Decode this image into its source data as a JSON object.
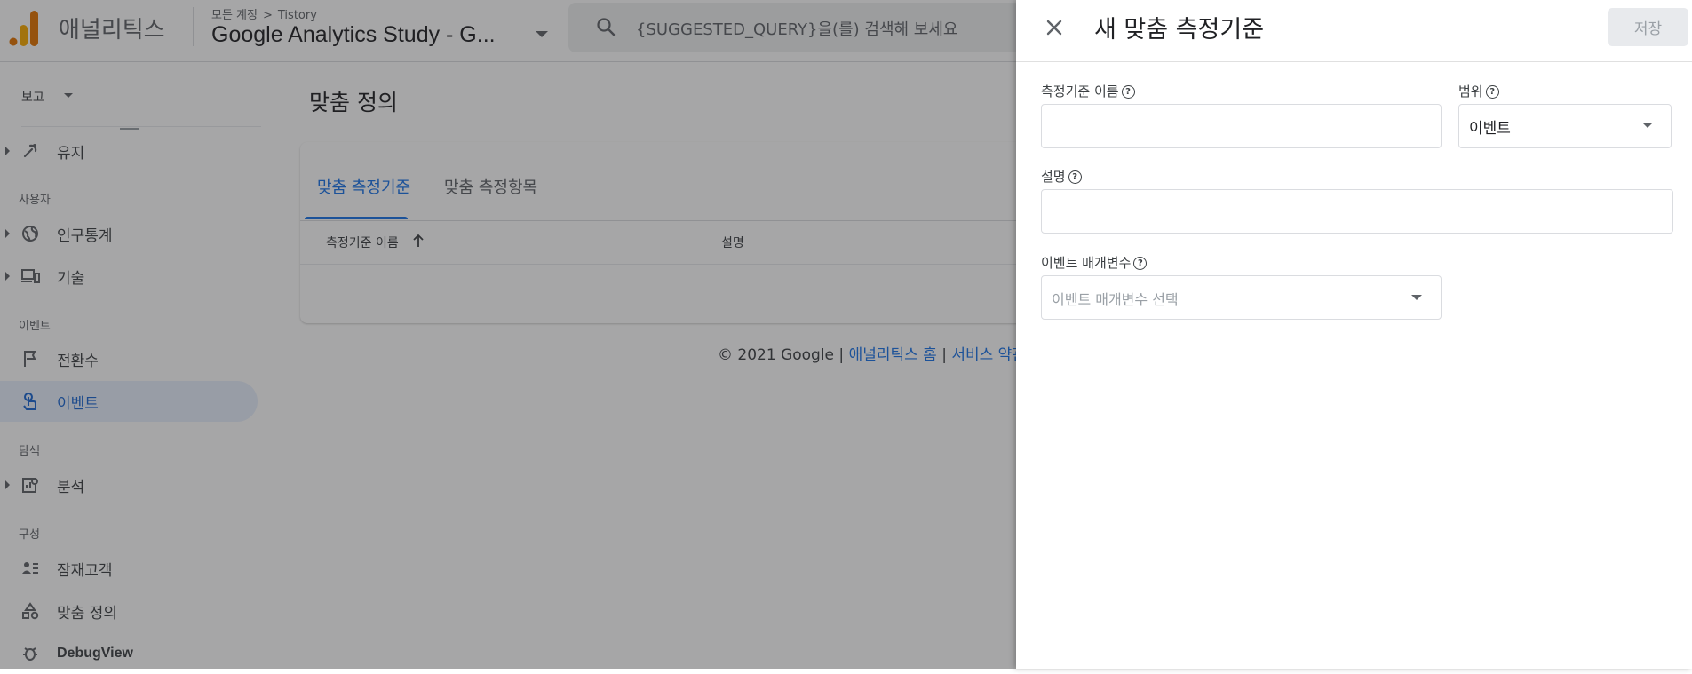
{
  "app": {
    "product_name": "애널리틱스",
    "breadcrumb": {
      "all_accounts": "모든 계정",
      "separator": ">",
      "account": "Tistory"
    },
    "property_name": "Google Analytics Study - G...",
    "search_placeholder": "{SUGGESTED_QUERY}을(를) 검색해 보세요"
  },
  "sidebar": {
    "report_selector": "보고",
    "items": [
      {
        "label": "유지",
        "icon": "retention-icon"
      },
      {
        "section": "사용자"
      },
      {
        "label": "인구통계",
        "icon": "globe-icon"
      },
      {
        "label": "기술",
        "icon": "devices-icon"
      },
      {
        "section": "이벤트"
      },
      {
        "label": "전환수",
        "icon": "flag-icon"
      },
      {
        "label": "이벤트",
        "icon": "touch-icon",
        "active": true
      },
      {
        "section": "탐색"
      },
      {
        "label": "분석",
        "icon": "analysis-icon"
      },
      {
        "section": "구성"
      },
      {
        "label": "잠재고객",
        "icon": "audience-icon"
      },
      {
        "label": "맞춤 정의",
        "icon": "shapes-icon"
      },
      {
        "label": "DebugView",
        "icon": "bug-icon"
      }
    ]
  },
  "main": {
    "title": "맞춤 정의",
    "tabs": [
      {
        "label": "맞춤 측정기준"
      },
      {
        "label": "맞춤 측정항목"
      }
    ],
    "table_headers": [
      "측정기준 이름",
      "설명"
    ],
    "footer": {
      "copyright": "© 2021 Google |",
      "home_link": "애널리틱스 홈",
      "sep": "|",
      "terms_link": "서비스 약관"
    }
  },
  "panel": {
    "title": "새 맞춤 측정기준",
    "save_label": "저장",
    "dimension_name_label": "측정기준 이름",
    "scope_label": "범위",
    "scope_value": "이벤트",
    "description_label": "설명",
    "event_param_label": "이벤트 매개변수",
    "event_param_placeholder": "이벤트 매개변수 선택",
    "help_glyph": "?"
  },
  "colors": {
    "accent": "#1a73e8",
    "active_bg": "#e8f0fe",
    "logo_orange": "#f9ab00",
    "logo_dark": "#e37400"
  }
}
